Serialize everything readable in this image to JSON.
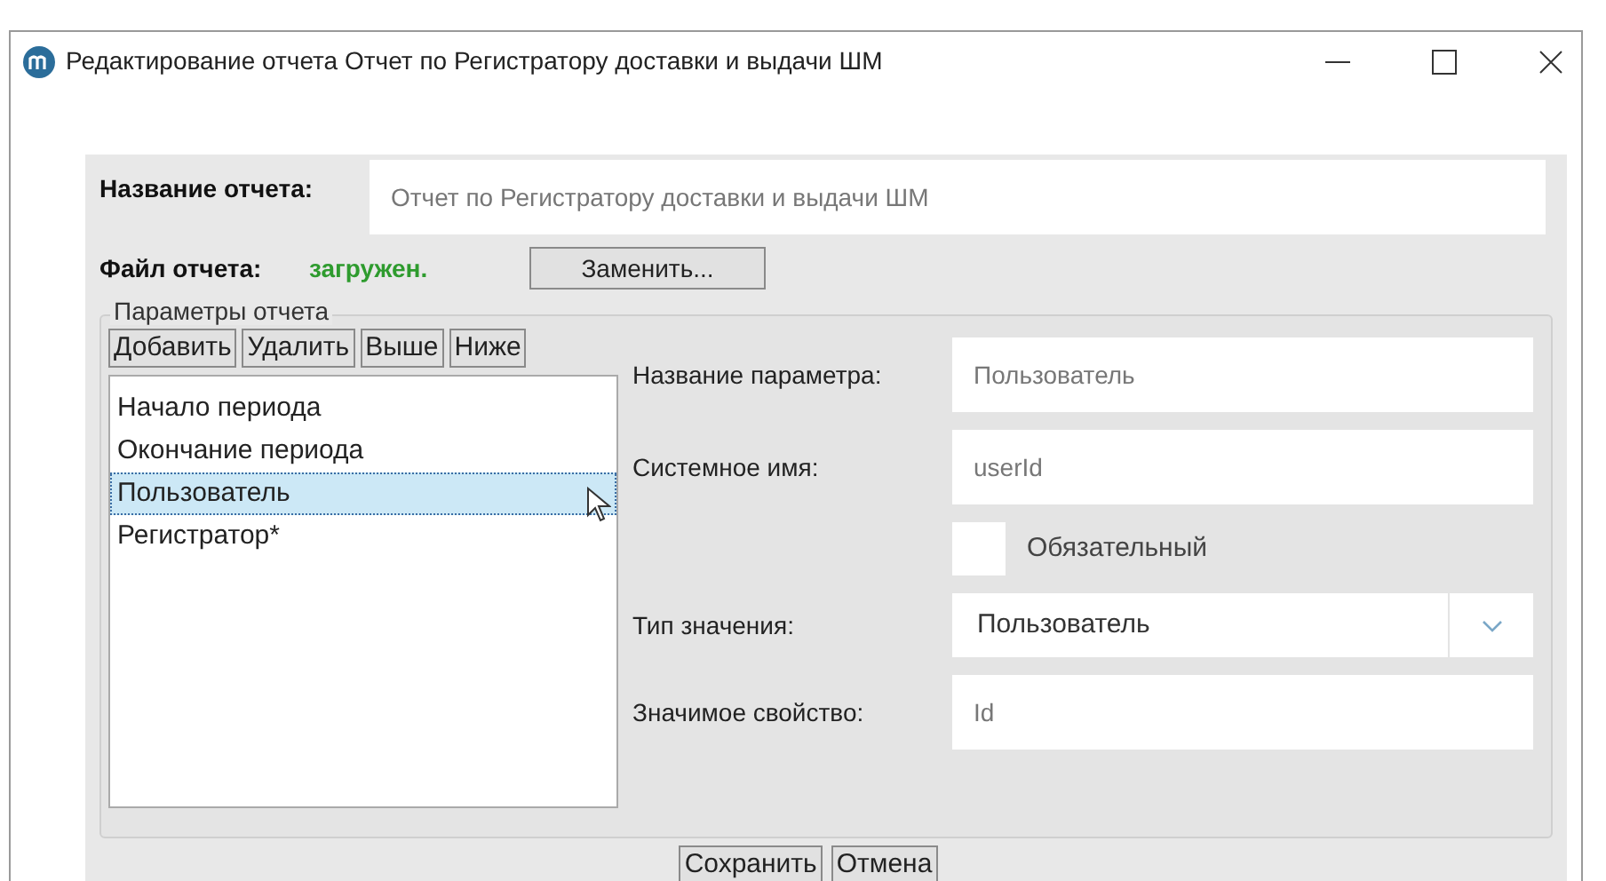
{
  "window": {
    "title": "Редактирование отчета Отчет по Регистратору доставки и выдачи ШМ"
  },
  "report_name": {
    "label": "Название отчета:",
    "value": "Отчет по Регистратору доставки и выдачи ШМ"
  },
  "report_file": {
    "label": "Файл отчета:",
    "status": "загружен.",
    "button": "Заменить..."
  },
  "parameters": {
    "title": "Параметры отчета",
    "toolbar": [
      "Добавить",
      "Удалить",
      "Выше",
      "Ниже"
    ],
    "items": [
      {
        "label": "Начало периода",
        "selected": false
      },
      {
        "label": "Окончание периода",
        "selected": false
      },
      {
        "label": "Пользователь",
        "selected": true
      },
      {
        "label": "Регистратор*",
        "selected": false
      }
    ],
    "form": [
      {
        "kind": "text",
        "label": "Название параметра:",
        "value": "Пользователь"
      },
      {
        "kind": "text",
        "label": "Системное имя:",
        "value": "userId"
      },
      {
        "kind": "checkbox",
        "label": "Обязательный",
        "checked": false
      },
      {
        "kind": "select",
        "label": "Тип значения:",
        "value": "Пользователь"
      },
      {
        "kind": "text",
        "label": "Значимое свойство:",
        "value": "Id"
      }
    ]
  },
  "buttons": [
    "Сохранить",
    "Отмена"
  ]
}
